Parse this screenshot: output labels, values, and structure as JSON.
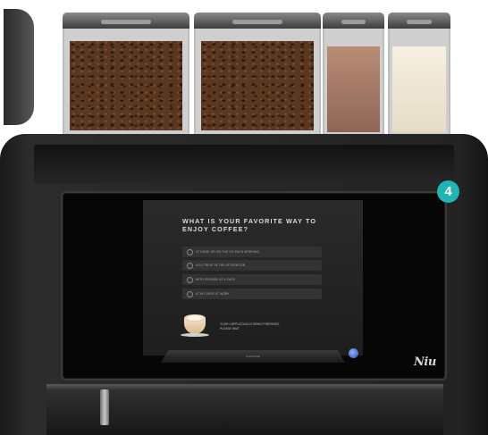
{
  "screen": {
    "question": "WHAT IS YOUR FAVORITE WAY TO ENJOY COFFEE?",
    "options": [
      "AT HOME OR ON THE GO EACH MORNING",
      "AS A TREAT IN THE AFTERNOON",
      "WITH FRIENDS AT A CAFE",
      "AT MY DESK AT WORK"
    ],
    "cup_text_line1": "YOUR CAPPUCCINO IS BEING PREPARED",
    "cup_text_line2": "PLEASE WAIT",
    "tray_label": "CONTINUE"
  },
  "badge": {
    "number": "4",
    "color": "#1fb5b2"
  },
  "logo": {
    "text": "Niu"
  },
  "hoppers": [
    {
      "name": "coffee-bean-hopper-left",
      "color": "#5a3720"
    },
    {
      "name": "coffee-bean-hopper-right",
      "color": "#5a3720"
    },
    {
      "name": "chocolate-powder-hopper",
      "color": "#a27966"
    },
    {
      "name": "milk-powder-hopper",
      "color": "#efe6d3"
    }
  ]
}
